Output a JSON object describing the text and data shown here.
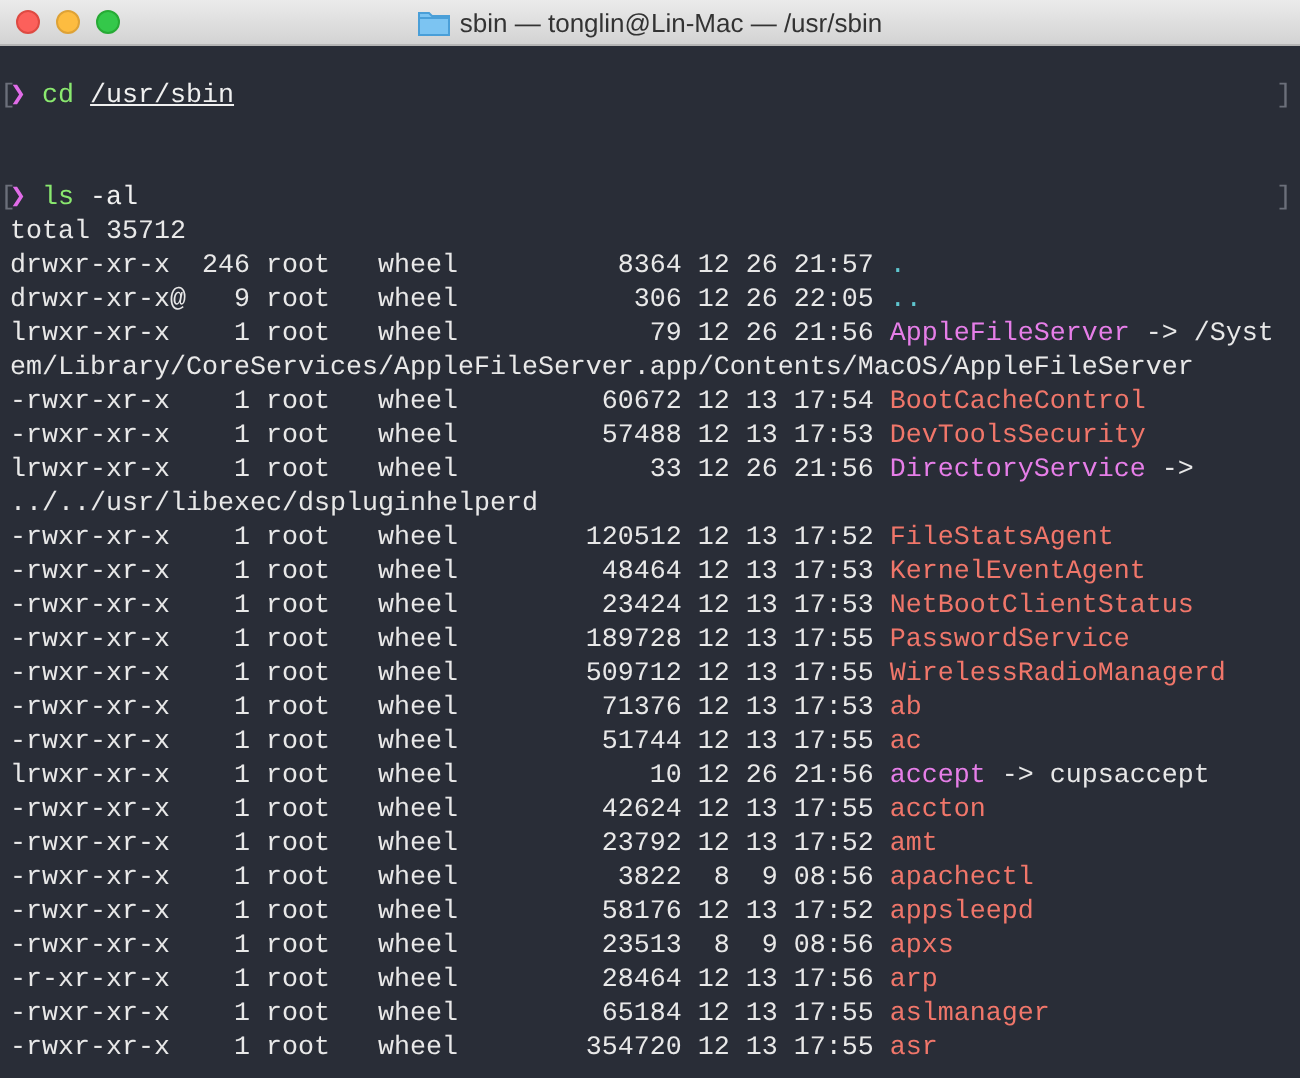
{
  "window": {
    "title": "sbin — tonglin@Lin-Mac — /usr/sbin"
  },
  "prompts": [
    {
      "open_mark": "[",
      "symbol": "❯",
      "command": "cd",
      "argument": "/usr/sbin",
      "argument_underlined": true,
      "close_mark": "]"
    },
    {
      "open_mark": "[",
      "symbol": "❯",
      "command": "ls",
      "argument": "-al",
      "argument_underlined": false,
      "close_mark": "]"
    }
  ],
  "total": "total 35712",
  "rows": [
    {
      "mode": "drwxr-xr-x",
      "links": "246",
      "owner": "root",
      "group": "wheel",
      "size": "8364",
      "month": "12",
      "day": "26",
      "time": "21:57",
      "name": ".",
      "kind": "dir"
    },
    {
      "mode": "drwxr-xr-x@",
      "links": "9",
      "owner": "root",
      "group": "wheel",
      "size": "306",
      "month": "12",
      "day": "26",
      "time": "22:05",
      "name": "..",
      "kind": "dir"
    },
    {
      "mode": "lrwxr-xr-x",
      "links": "1",
      "owner": "root",
      "group": "wheel",
      "size": "79",
      "month": "12",
      "day": "26",
      "time": "21:56",
      "name": "AppleFileServer",
      "kind": "link",
      "arrow": "->",
      "target": "/System/Library/CoreServices/AppleFileServer.app/Contents/MacOS/AppleFileServer"
    },
    {
      "mode": "-rwxr-xr-x",
      "links": "1",
      "owner": "root",
      "group": "wheel",
      "size": "60672",
      "month": "12",
      "day": "13",
      "time": "17:54",
      "name": "BootCacheControl",
      "kind": "exec"
    },
    {
      "mode": "-rwxr-xr-x",
      "links": "1",
      "owner": "root",
      "group": "wheel",
      "size": "57488",
      "month": "12",
      "day": "13",
      "time": "17:53",
      "name": "DevToolsSecurity",
      "kind": "exec"
    },
    {
      "mode": "lrwxr-xr-x",
      "links": "1",
      "owner": "root",
      "group": "wheel",
      "size": "33",
      "month": "12",
      "day": "26",
      "time": "21:56",
      "name": "DirectoryService",
      "kind": "link",
      "arrow": "->",
      "target": "../../usr/libexec/dspluginhelperd"
    },
    {
      "mode": "-rwxr-xr-x",
      "links": "1",
      "owner": "root",
      "group": "wheel",
      "size": "120512",
      "month": "12",
      "day": "13",
      "time": "17:52",
      "name": "FileStatsAgent",
      "kind": "exec"
    },
    {
      "mode": "-rwxr-xr-x",
      "links": "1",
      "owner": "root",
      "group": "wheel",
      "size": "48464",
      "month": "12",
      "day": "13",
      "time": "17:53",
      "name": "KernelEventAgent",
      "kind": "exec"
    },
    {
      "mode": "-rwxr-xr-x",
      "links": "1",
      "owner": "root",
      "group": "wheel",
      "size": "23424",
      "month": "12",
      "day": "13",
      "time": "17:53",
      "name": "NetBootClientStatus",
      "kind": "exec"
    },
    {
      "mode": "-rwxr-xr-x",
      "links": "1",
      "owner": "root",
      "group": "wheel",
      "size": "189728",
      "month": "12",
      "day": "13",
      "time": "17:55",
      "name": "PasswordService",
      "kind": "exec"
    },
    {
      "mode": "-rwxr-xr-x",
      "links": "1",
      "owner": "root",
      "group": "wheel",
      "size": "509712",
      "month": "12",
      "day": "13",
      "time": "17:55",
      "name": "WirelessRadioManagerd",
      "kind": "exec"
    },
    {
      "mode": "-rwxr-xr-x",
      "links": "1",
      "owner": "root",
      "group": "wheel",
      "size": "71376",
      "month": "12",
      "day": "13",
      "time": "17:53",
      "name": "ab",
      "kind": "exec"
    },
    {
      "mode": "-rwxr-xr-x",
      "links": "1",
      "owner": "root",
      "group": "wheel",
      "size": "51744",
      "month": "12",
      "day": "13",
      "time": "17:55",
      "name": "ac",
      "kind": "exec"
    },
    {
      "mode": "lrwxr-xr-x",
      "links": "1",
      "owner": "root",
      "group": "wheel",
      "size": "10",
      "month": "12",
      "day": "26",
      "time": "21:56",
      "name": "accept",
      "kind": "link",
      "arrow": "->",
      "target": "cupsaccept"
    },
    {
      "mode": "-rwxr-xr-x",
      "links": "1",
      "owner": "root",
      "group": "wheel",
      "size": "42624",
      "month": "12",
      "day": "13",
      "time": "17:55",
      "name": "accton",
      "kind": "exec"
    },
    {
      "mode": "-rwxr-xr-x",
      "links": "1",
      "owner": "root",
      "group": "wheel",
      "size": "23792",
      "month": "12",
      "day": "13",
      "time": "17:52",
      "name": "amt",
      "kind": "exec"
    },
    {
      "mode": "-rwxr-xr-x",
      "links": "1",
      "owner": "root",
      "group": "wheel",
      "size": "3822",
      "month": "8",
      "day": "9",
      "time": "08:56",
      "name": "apachectl",
      "kind": "exec"
    },
    {
      "mode": "-rwxr-xr-x",
      "links": "1",
      "owner": "root",
      "group": "wheel",
      "size": "58176",
      "month": "12",
      "day": "13",
      "time": "17:52",
      "name": "appsleepd",
      "kind": "exec"
    },
    {
      "mode": "-rwxr-xr-x",
      "links": "1",
      "owner": "root",
      "group": "wheel",
      "size": "23513",
      "month": "8",
      "day": "9",
      "time": "08:56",
      "name": "apxs",
      "kind": "exec"
    },
    {
      "mode": "-r-xr-xr-x",
      "links": "1",
      "owner": "root",
      "group": "wheel",
      "size": "28464",
      "month": "12",
      "day": "13",
      "time": "17:56",
      "name": "arp",
      "kind": "exec"
    },
    {
      "mode": "-rwxr-xr-x",
      "links": "1",
      "owner": "root",
      "group": "wheel",
      "size": "65184",
      "month": "12",
      "day": "13",
      "time": "17:55",
      "name": "aslmanager",
      "kind": "exec"
    },
    {
      "mode": "-rwxr-xr-x",
      "links": "1",
      "owner": "root",
      "group": "wheel",
      "size": "354720",
      "month": "12",
      "day": "13",
      "time": "17:55",
      "name": "asr",
      "kind": "exec"
    }
  ]
}
